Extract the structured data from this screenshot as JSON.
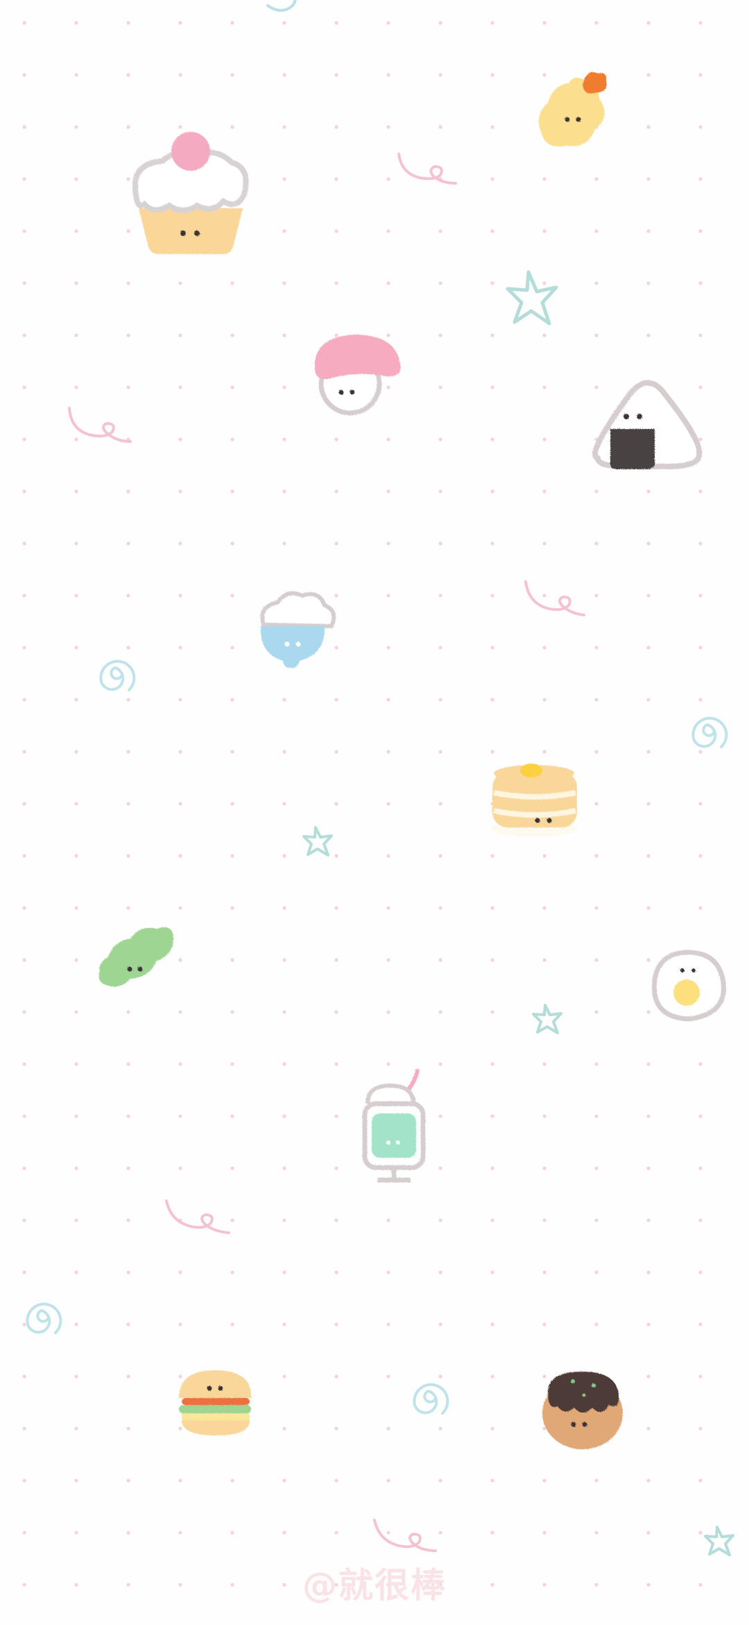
{
  "wallpaper": {
    "background": "#fffefe",
    "dot_color": "#f6d3da",
    "watermark": "@就很棒"
  },
  "items": [
    {
      "name": "cupcake",
      "icon": "cupcake-icon"
    },
    {
      "name": "tempura-shrimp",
      "icon": "tempura-icon"
    },
    {
      "name": "mushroom",
      "icon": "mushroom-icon"
    },
    {
      "name": "onigiri",
      "icon": "onigiri-icon"
    },
    {
      "name": "rice-bowl",
      "icon": "rice-bowl-icon"
    },
    {
      "name": "pancakes",
      "icon": "pancake-stack-icon"
    },
    {
      "name": "edamame",
      "icon": "edamame-icon"
    },
    {
      "name": "fried-egg",
      "icon": "fried-egg-icon"
    },
    {
      "name": "cream-soda",
      "icon": "cream-soda-icon"
    },
    {
      "name": "hamburger",
      "icon": "hamburger-icon"
    },
    {
      "name": "takoyaki",
      "icon": "takoyaki-icon"
    }
  ]
}
